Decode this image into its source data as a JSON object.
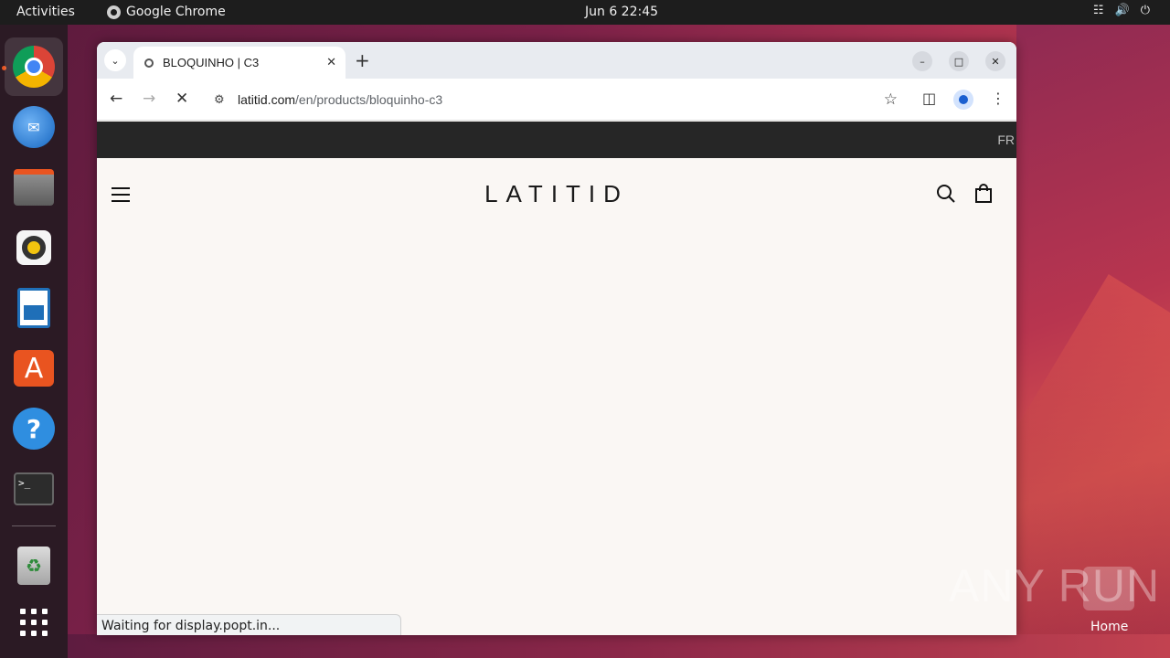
{
  "topbar": {
    "activities": "Activities",
    "app_name": "Google Chrome",
    "clock": "Jun 6  22:45"
  },
  "dock": {
    "items": [
      "chrome-icon",
      "thunderbird-icon",
      "files-icon",
      "rhythmbox-icon",
      "writer-icon",
      "app-center-icon",
      "help-icon",
      "terminal-icon",
      "trash-icon",
      "apps-grid-icon"
    ]
  },
  "browser": {
    "tab_title": "BLOQUINHO | C3",
    "url_host": "latitid.com",
    "url_path": "/en/products/bloquinho-c3",
    "status_text": "Waiting for display.popt.in..."
  },
  "page": {
    "lang": "FR",
    "logo": "LATITID"
  },
  "desktop": {
    "watermark": "ANY RUN",
    "home_label": "Home"
  },
  "colors": {
    "topbar": "#1d1d1d",
    "announce_bar": "#262626",
    "page_bg": "#faf7f4",
    "accent": "#e95420"
  }
}
